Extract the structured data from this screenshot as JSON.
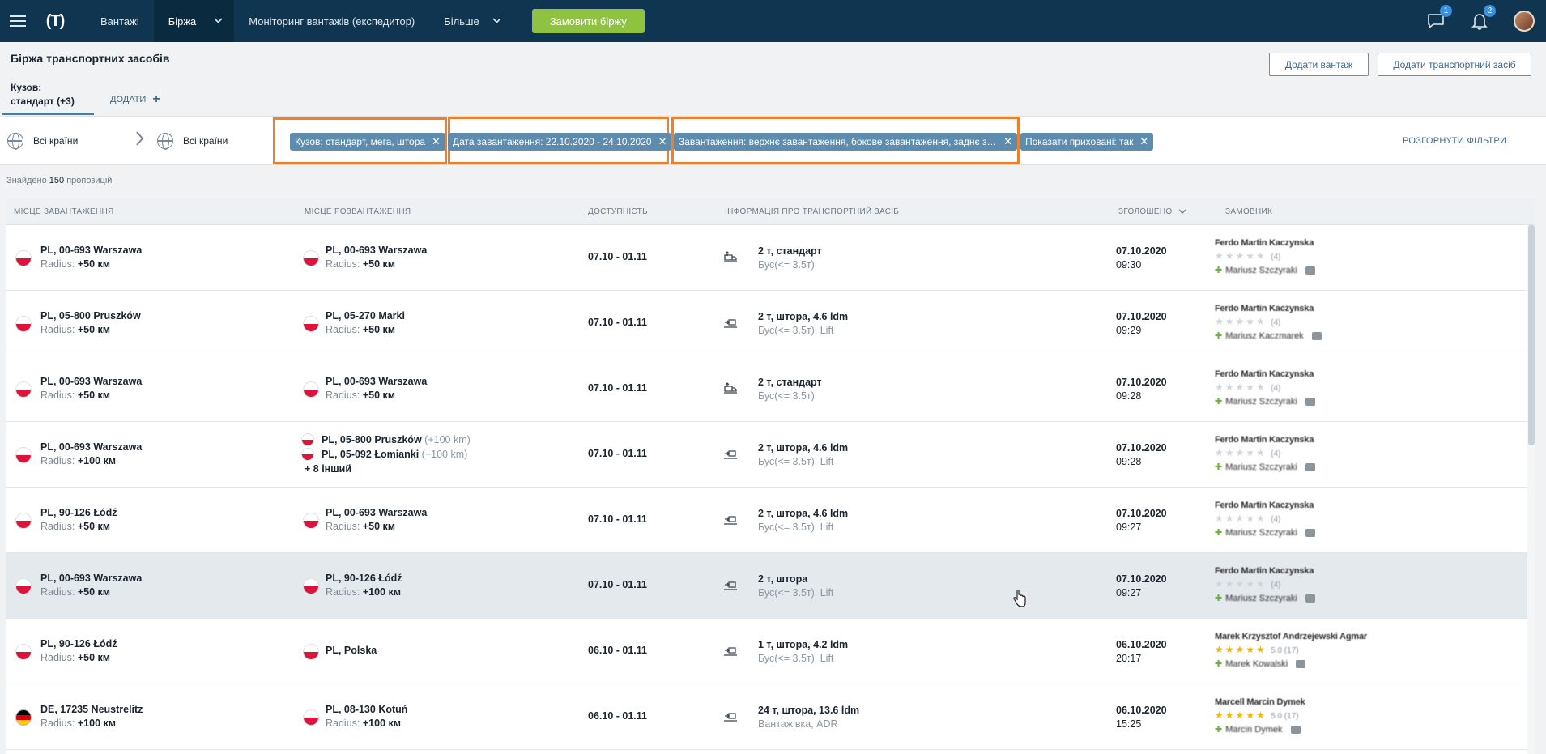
{
  "nav": {
    "items": [
      {
        "label": "Вантажі"
      },
      {
        "label": "Біржа"
      },
      {
        "label": "Моніторинг вантажів (експедитор)"
      },
      {
        "label": "Більше"
      }
    ],
    "order_button": "Замовити біржу",
    "chat_badge": "1",
    "notif_badge": "2",
    "logo": "(T)"
  },
  "page": {
    "title": "Біржа транспортних засобів",
    "add_cargo": "Додати вантаж",
    "add_vehicle": "Додати транспортний засіб",
    "tab_line1": "Кузов:",
    "tab_line2": "стандарт (+3)",
    "add_filter": "ДОДАТИ"
  },
  "filters": {
    "from_country": "Всі країни",
    "to_country": "Всі країни",
    "chips": [
      "Кузов: стандарт, мега, штора",
      "Дата завантаження: 22.10.2020 - 24.10.2020",
      "Завантаження: верхнє завантаження, бокове завантаження, заднє за...",
      "Показати приховані: так"
    ],
    "expand": "РОЗГОРНУТИ ФІЛЬТРИ"
  },
  "found": {
    "prefix": "Знайдено",
    "count": "150",
    "suffix": "пропозицій"
  },
  "table": {
    "headers": {
      "load": "Місце завантаження",
      "unload": "Місце розвантаження",
      "avail": "Доступність",
      "vehicle": "Інформація про транспортний засіб",
      "reported": "Зголошено",
      "customer": "Замовник"
    },
    "radius_label": "Radius:",
    "rows": [
      {
        "from_flag": "pl",
        "from": "PL, 00-693 Warszawa",
        "from_radius": "+50 км",
        "to": [
          {
            "flag": "pl",
            "text": "PL, 00-693 Warszawa",
            "km": ""
          }
        ],
        "to_radius": "+50 км",
        "to_more": "",
        "avail": "07.10 - 01.11",
        "veh_main": "2 т, стандарт",
        "veh_sub": "Бус(<= 3.5т)",
        "date": "07.10.2020",
        "time": "09:30",
        "cust_name": "Ferdo Martin Kaczynska",
        "stars": 0,
        "cnt": "(4)",
        "contact": "Mariusz Szczyraki"
      },
      {
        "from_flag": "pl",
        "from": "PL, 05-800 Pruszków",
        "from_radius": "+50 км",
        "to": [
          {
            "flag": "pl",
            "text": "PL, 05-270 Marki",
            "km": ""
          }
        ],
        "to_radius": "+50 км",
        "to_more": "",
        "avail": "07.10 - 01.11",
        "veh_main": "2 т, штора, 4.6 ldm",
        "veh_sub": "Бус(<= 3.5т), Lift",
        "date": "07.10.2020",
        "time": "09:29",
        "cust_name": "Ferdo Martin Kaczynska",
        "stars": 0,
        "cnt": "(4)",
        "contact": "Mariusz Kaczmarek"
      },
      {
        "from_flag": "pl",
        "from": "PL, 00-693 Warszawa",
        "from_radius": "+50 км",
        "to": [
          {
            "flag": "pl",
            "text": "PL, 00-693 Warszawa",
            "km": ""
          }
        ],
        "to_radius": "+50 км",
        "to_more": "",
        "avail": "07.10 - 01.11",
        "veh_main": "2 т, стандарт",
        "veh_sub": "Бус(<= 3.5т)",
        "date": "07.10.2020",
        "time": "09:28",
        "cust_name": "Ferdo Martin Kaczynska",
        "stars": 0,
        "cnt": "(4)",
        "contact": "Mariusz Szczyraki"
      },
      {
        "from_flag": "pl",
        "from": "PL, 00-693 Warszawa",
        "from_radius": "+100 км",
        "to": [
          {
            "flag": "pl",
            "text": "PL, 05-800 Pruszków",
            "km": "(+100 km)"
          },
          {
            "flag": "pl",
            "text": "PL, 05-092 Łomianki",
            "km": "(+100 km)"
          }
        ],
        "to_radius": "",
        "to_more": "+ 8 інший",
        "avail": "07.10 - 01.11",
        "veh_main": "2 т, штора, 4.6 ldm",
        "veh_sub": "Бус(<= 3.5т), Lift",
        "date": "07.10.2020",
        "time": "09:28",
        "cust_name": "Ferdo Martin Kaczynska",
        "stars": 0,
        "cnt": "(4)",
        "contact": "Mariusz Szczyraki"
      },
      {
        "from_flag": "pl",
        "from": "PL, 90-126 Łódź",
        "from_radius": "+50 км",
        "to": [
          {
            "flag": "pl",
            "text": "PL, 00-693 Warszawa",
            "km": ""
          }
        ],
        "to_radius": "+50 км",
        "to_more": "",
        "avail": "07.10 - 01.11",
        "veh_main": "2 т, штора, 4.6 ldm",
        "veh_sub": "Бус(<= 3.5т), Lift",
        "date": "07.10.2020",
        "time": "09:27",
        "cust_name": "Ferdo Martin Kaczynska",
        "stars": 0,
        "cnt": "(4)",
        "contact": "Mariusz Szczyraki"
      },
      {
        "from_flag": "pl",
        "from": "PL, 00-693 Warszawa",
        "from_radius": "+50 км",
        "to": [
          {
            "flag": "pl",
            "text": "PL, 90-126 Łódź",
            "km": ""
          }
        ],
        "to_radius": "+100 км",
        "to_more": "",
        "avail": "07.10 - 01.11",
        "veh_main": "2 т, штора",
        "veh_sub": "Бус(<= 3.5т), Lift",
        "date": "07.10.2020",
        "time": "09:27",
        "cust_name": "Ferdo Martin Kaczynska",
        "stars": 0,
        "cnt": "(4)",
        "contact": "Mariusz Szczyraki"
      },
      {
        "from_flag": "pl",
        "from": "PL, 90-126 Łódź",
        "from_radius": "+50 км",
        "to": [
          {
            "flag": "pl",
            "text": "PL, Polska",
            "km": ""
          }
        ],
        "to_radius": "",
        "to_more": "",
        "avail": "06.10 - 01.11",
        "veh_main": "1 т, штора, 4.2 ldm",
        "veh_sub": "Бус(<= 3.5т), Lift",
        "date": "06.10.2020",
        "time": "20:17",
        "cust_name": "Marek Krzysztof Andrzejewski Agmar",
        "stars": 5,
        "cnt": "5.0 (17)",
        "contact": "Marek Kowalski"
      },
      {
        "from_flag": "de",
        "from": "DE, 17235 Neustrelitz",
        "from_radius": "+100 км",
        "to": [
          {
            "flag": "pl",
            "text": "PL, 08-130 Kotuń",
            "km": ""
          }
        ],
        "to_radius": "+100 км",
        "to_more": "",
        "avail": "06.10 - 01.11",
        "veh_main": "24 т, штора, 13.6 ldm",
        "veh_sub": "Вантажівка, ADR",
        "date": "06.10.2020",
        "time": "15:25",
        "cust_name": "Marcell Marcin Dymek",
        "stars": 5,
        "cnt": "5.0 (17)",
        "contact": "Marcin Dymek"
      }
    ]
  }
}
